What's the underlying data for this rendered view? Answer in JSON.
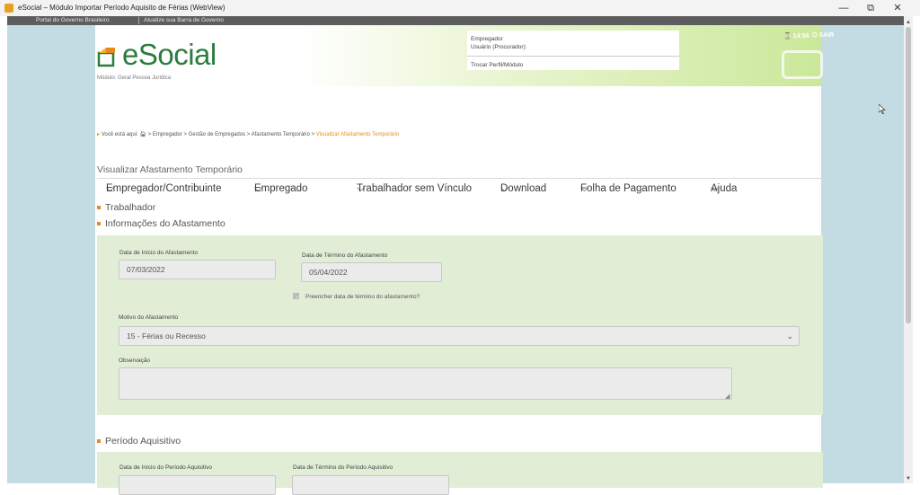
{
  "window": {
    "title": "eSocial – Módulo Importar Período Aquisito de Férias (WebView)",
    "minimize": "—",
    "restore": "⧉",
    "close": "✕"
  },
  "govbar": {
    "portal": "Portal do Governo Brasileiro",
    "atualize": "Atualize sua Barra de Governo"
  },
  "header": {
    "logo_text": "eSocial",
    "modulo": "Módulo: Geral Pessoa Jurídica",
    "empregador": "Empregador",
    "usuario": "Usuário (Procurador):",
    "trocar": "Trocar Perfil/Módulo",
    "clock": "14:56",
    "sair": "SAIR"
  },
  "nav": {
    "items": [
      {
        "label": "Empregador/Contribuinte"
      },
      {
        "label": "Empregado"
      },
      {
        "label": "Trabalhador sem Vínculo"
      },
      {
        "label": "Download"
      },
      {
        "label": "Folha de Pagamento"
      },
      {
        "label": "Ajuda"
      }
    ]
  },
  "breadcrumb": {
    "prefix": "Você está aqui:",
    "path": "> Empregador > Gestão de Empregados > Afastamento Temporário >",
    "current": "Visualizar Afastamento Temporário"
  },
  "page": {
    "title": "Visualizar Afastamento Temporário"
  },
  "sections": {
    "trabalhador": "Trabalhador",
    "informacoes": "Informações do Afastamento",
    "periodo": "Período Aquisitivo"
  },
  "afastamento": {
    "inicio_label": "Data de Início do Afastamento",
    "inicio_value": "07/03/2022",
    "termino_label": "Data de Término do Afastamento",
    "termino_value": "05/04/2022",
    "preencher_label": "Preencher data de término do afastamento?",
    "motivo_label": "Motivo do Afastamento",
    "motivo_value": "15 - Férias ou Recesso",
    "observacao_label": "Observação",
    "observacao_value": ""
  },
  "periodo_aquisitivo": {
    "inicio_label": "Data de Início do Período Aquisitivo",
    "termino_label": "Data de Término do Período Aquisitivo"
  },
  "colors": {
    "accent_orange": "#e38b1d",
    "brand_green": "#2b7d3d",
    "panel_green": "#e2edd6",
    "side_blue": "#c3dbe2"
  }
}
